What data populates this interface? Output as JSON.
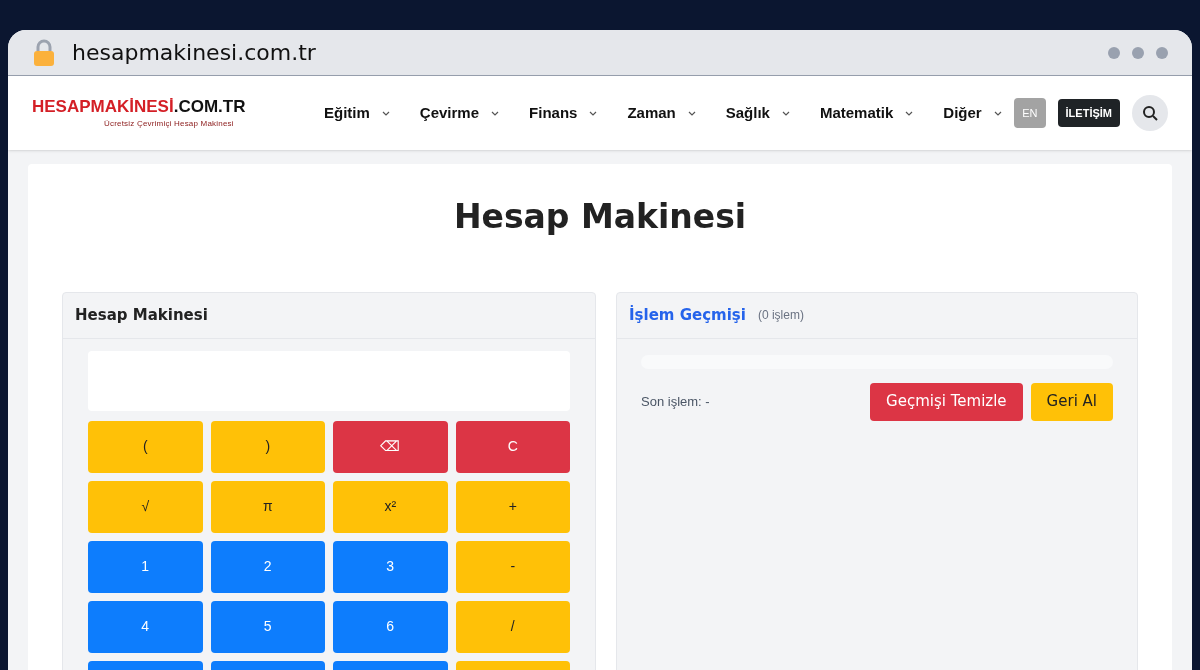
{
  "browser": {
    "address": "hesapmakinesi.com.tr"
  },
  "header": {
    "logo": {
      "brand": "HESAPMAKİNESİ",
      "domain": ".COM.TR",
      "tagline": "Ücretsiz Çevrimiçi Hesap Makinesi"
    },
    "nav": [
      "Eğitim",
      "Çevirme",
      "Finans",
      "Zaman",
      "Sağlık",
      "Matematik",
      "Diğer"
    ],
    "language_button": "EN",
    "contact_button": "İLETİŞİM"
  },
  "page_title": "Hesap Makinesi",
  "calculator": {
    "title": "Hesap Makinesi",
    "keys": [
      {
        "label": "(",
        "kind": "operator"
      },
      {
        "label": ")",
        "kind": "operator"
      },
      {
        "label": "⌫",
        "kind": "delete"
      },
      {
        "label": "C",
        "kind": "clear"
      },
      {
        "label": "√",
        "kind": "operator"
      },
      {
        "label": "π",
        "kind": "operator"
      },
      {
        "label": "x²",
        "kind": "operator"
      },
      {
        "label": "+",
        "kind": "operator"
      },
      {
        "label": "1",
        "kind": "number"
      },
      {
        "label": "2",
        "kind": "number"
      },
      {
        "label": "3",
        "kind": "number"
      },
      {
        "label": "-",
        "kind": "operator"
      },
      {
        "label": "4",
        "kind": "number"
      },
      {
        "label": "5",
        "kind": "number"
      },
      {
        "label": "6",
        "kind": "number"
      },
      {
        "label": "/",
        "kind": "operator"
      },
      {
        "kind": "number"
      },
      {
        "kind": "number"
      },
      {
        "kind": "number"
      },
      {
        "kind": "operator"
      }
    ]
  },
  "history": {
    "title": "İşlem Geçmişi",
    "count": "(0 işlem)",
    "last_operation": "Son işlem: -",
    "clear_button": "Geçmişi Temizle",
    "undo_button": "Geri Al"
  }
}
